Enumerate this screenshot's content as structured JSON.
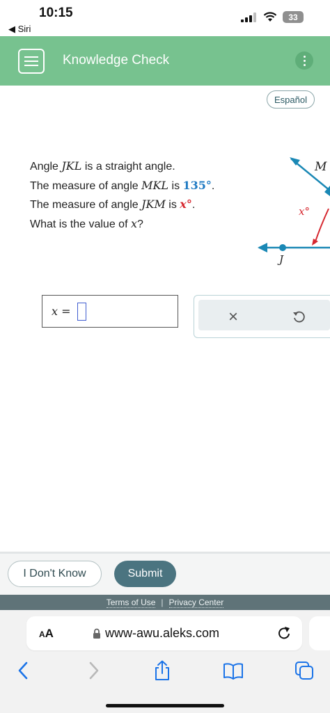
{
  "status_bar": {
    "time": "10:15",
    "back_app": "◀ Siri",
    "battery": "33"
  },
  "header": {
    "title": "Knowledge Check"
  },
  "language_button": "Español",
  "question": {
    "l1_a": "Angle ",
    "l1_m": "JKL",
    "l1_b": " is a straight angle.",
    "l2_a": "The measure of angle ",
    "l2_m": "MKL",
    "l2_b": " is ",
    "l2_v": "135°",
    "l2_c": ".",
    "l3_a": "The measure of angle ",
    "l3_m": "JKM",
    "l3_b": " is ",
    "l3_v": "x°",
    "l3_c": ".",
    "l4_a": "What is the value of ",
    "l4_m": "x",
    "l4_b": "?"
  },
  "diagram": {
    "label_m": "M",
    "label_j": "J",
    "label_x": "x°"
  },
  "answer": {
    "label": "x =",
    "value": ""
  },
  "tools": {
    "clear": "×"
  },
  "actions": {
    "dont_know": "I Don't Know",
    "submit": "Submit"
  },
  "footer": {
    "terms": "Terms of Use",
    "sep": "|",
    "privacy": "Privacy Center"
  },
  "browser": {
    "aa_small": "A",
    "aa_big": "A",
    "url": "www-awu.aleks.com"
  },
  "colors": {
    "header_green": "#77c28f",
    "accent_blue": "#1f7ac3",
    "accent_red": "#d6272f",
    "submit": "#4b7480"
  }
}
